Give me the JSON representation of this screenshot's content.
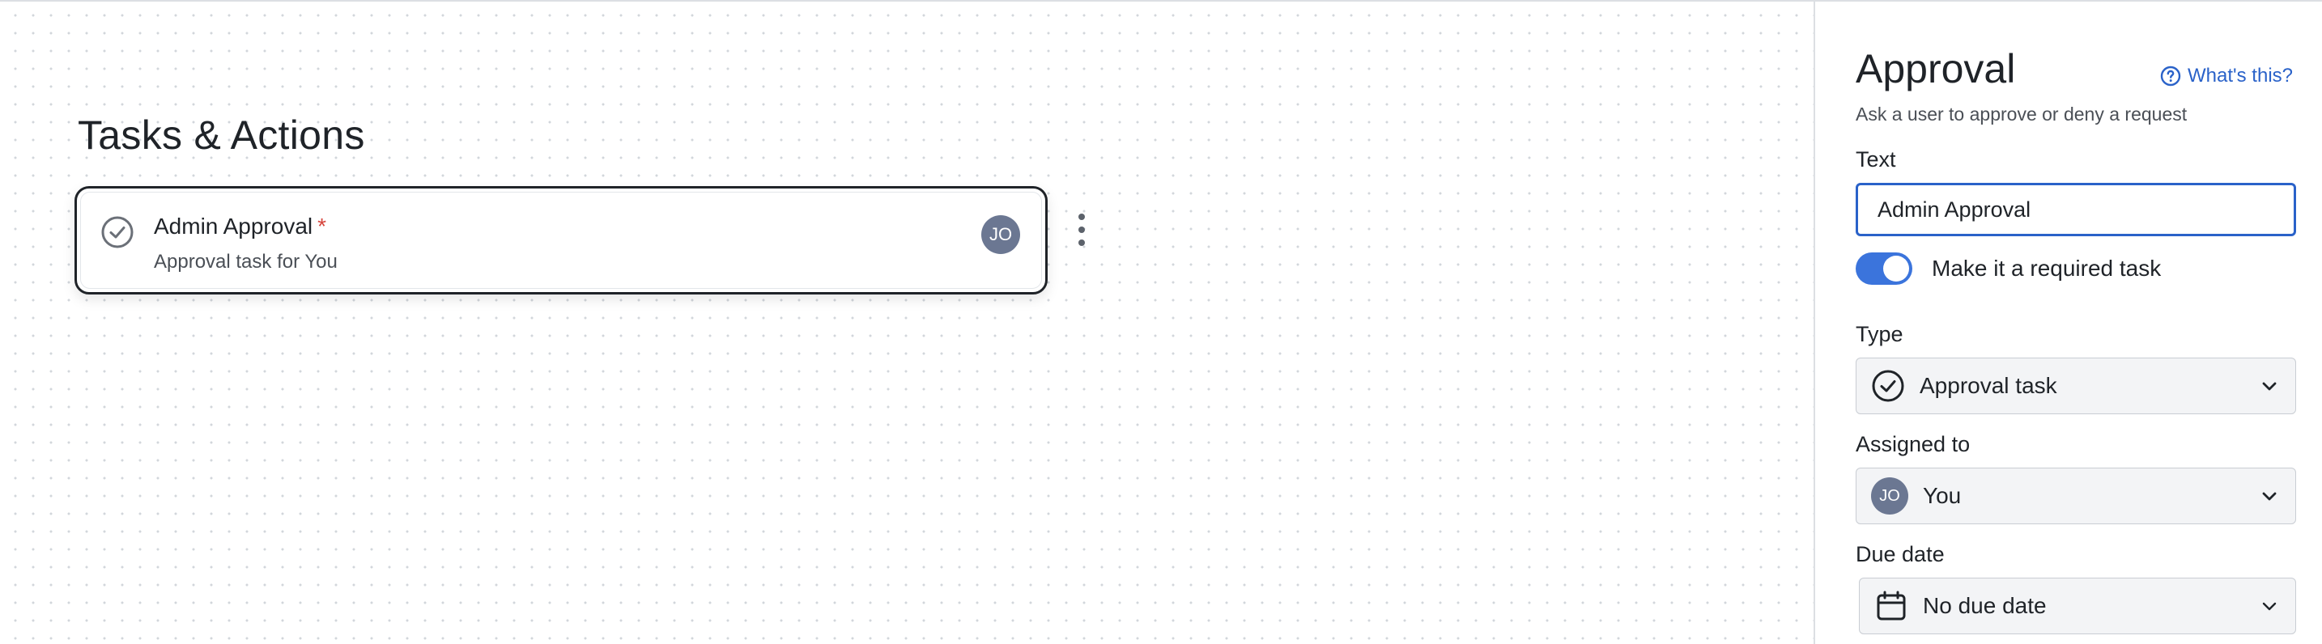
{
  "canvas": {
    "section_title": "Tasks & Actions",
    "task": {
      "title": "Admin Approval",
      "required_marker": "*",
      "subtitle": "Approval task for You",
      "assignee_initials": "JO"
    }
  },
  "panel": {
    "title": "Approval",
    "help_link": "What's this?",
    "description": "Ask a user to approve or deny a request",
    "text_field": {
      "label": "Text",
      "value": "Admin Approval"
    },
    "required_toggle": {
      "label": "Make it a required task",
      "on": true
    },
    "type_field": {
      "label": "Type",
      "value": "Approval task",
      "icon": "check-circle-icon"
    },
    "assigned_field": {
      "label": "Assigned to",
      "value": "You",
      "avatar_initials": "JO"
    },
    "due_field": {
      "label": "Due date",
      "value": "No due date",
      "icon": "calendar-icon"
    }
  },
  "colors": {
    "accent": "#2a62c9",
    "toggle_on": "#3b74dc",
    "avatar": "#6b7792",
    "required": "#d6453d"
  }
}
